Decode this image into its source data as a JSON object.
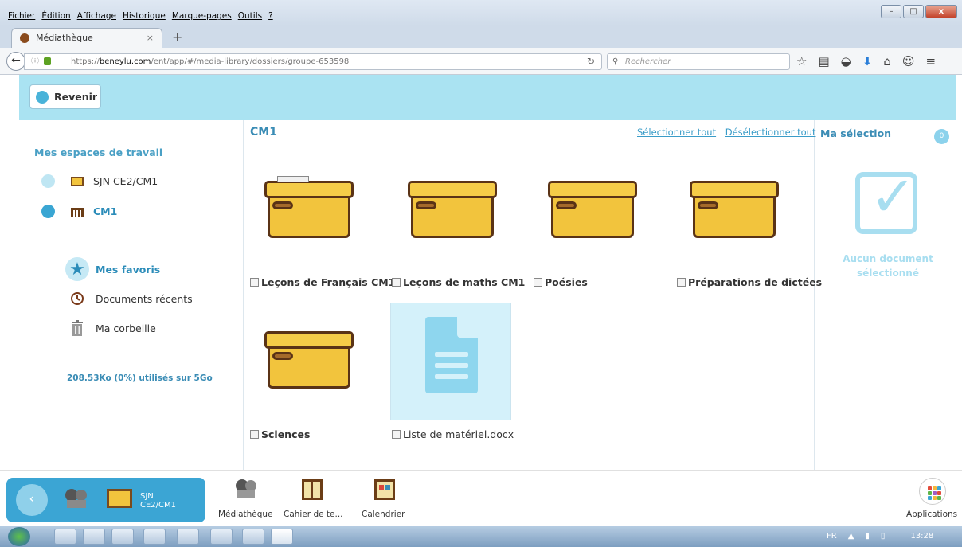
{
  "browser": {
    "menu": [
      "Fichier",
      "Édition",
      "Affichage",
      "Historique",
      "Marque-pages",
      "Outils",
      "?"
    ],
    "tab_title": "Médiathèque",
    "url_prefix": "https://",
    "url_host": "beneylu.com",
    "url_path": "/ent/app/#/media-library/dossiers/groupe-653598",
    "search_placeholder": "Rechercher"
  },
  "header": {
    "back_label": "Revenir"
  },
  "sidebar": {
    "title": "Mes espaces de travail",
    "workspaces": [
      {
        "label": "SJN CE2/CM1",
        "active": false
      },
      {
        "label": "CM1",
        "active": true
      }
    ],
    "links": [
      {
        "label": "Mes favoris"
      },
      {
        "label": "Documents récents"
      },
      {
        "label": "Ma corbeille"
      }
    ],
    "quota": "208.53Ko (0%) utilisés sur 5Go"
  },
  "main": {
    "title": "CM1",
    "select_all": "Sélectionner tout",
    "deselect_all": "Désélectionner tout",
    "folders": [
      {
        "label": "Leçons de Français CM1"
      },
      {
        "label": "Leçons de maths CM1"
      },
      {
        "label": "Poésies"
      },
      {
        "label": "Préparations de dictées"
      },
      {
        "label": "Sciences"
      }
    ],
    "file": {
      "label": "Liste de matériel.docx"
    }
  },
  "selection": {
    "title": "Ma sélection",
    "count": "0",
    "empty_text": "Aucun document sélectionné"
  },
  "dock": {
    "active_space": "SJN CE2/CM1",
    "apps": [
      "Médiathèque",
      "Cahier de te...",
      "Calendrier"
    ],
    "applications_label": "Applications"
  },
  "taskbar": {
    "lang": "FR",
    "time": "13:28"
  },
  "colors": {
    "accent": "#3aa6d3",
    "strip": "#aae3f2",
    "folder": "#f2c43d"
  }
}
